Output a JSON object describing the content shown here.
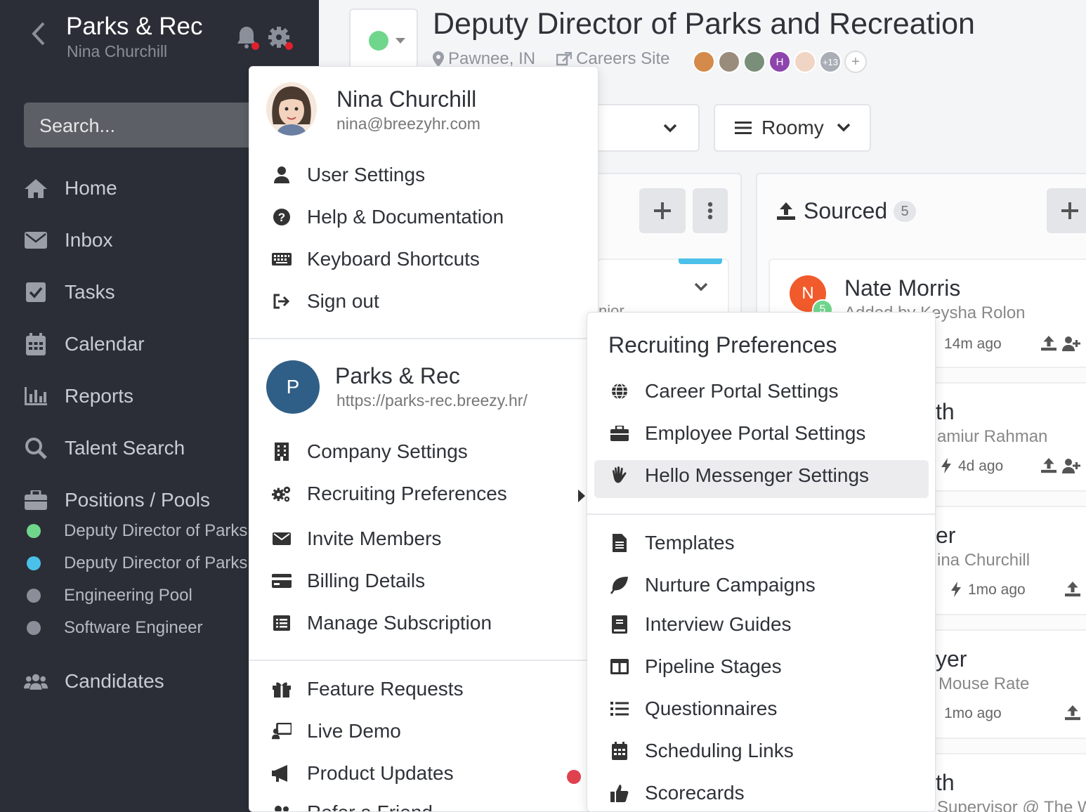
{
  "sidebar": {
    "org": "Parks & Rec",
    "user": "Nina Churchill",
    "search_placeholder": "Search...",
    "nav": [
      "Home",
      "Inbox",
      "Tasks",
      "Calendar",
      "Reports",
      "Talent Search",
      "Positions / Pools"
    ],
    "positions": [
      {
        "label": "Deputy Director of Parks and Recreation",
        "color": "#6fd68c"
      },
      {
        "label": "Deputy Director of Parks and Recreation",
        "color": "#4bc0e8"
      },
      {
        "label": "Engineering Pool",
        "color": "#8a8e98"
      },
      {
        "label": "Software Engineer",
        "color": "#8a8e98"
      }
    ],
    "candidates": "Candidates"
  },
  "header": {
    "title": "Deputy Director of Parks and Recreation",
    "location": "Pawnee, IN",
    "careers": "Careers Site",
    "extra_members": "+13",
    "add": "+",
    "member_initial": "H"
  },
  "toolbar": {
    "view": "Roomy"
  },
  "pipeline": {
    "sourced_label": "Sourced",
    "sourced_count": "5",
    "partial_text": "nior",
    "cards": [
      {
        "name": "Nate Morris",
        "initial": "N",
        "badge": "5",
        "sub": "Added by Keysha Rolon",
        "time": "14m ago"
      },
      {
        "name": "th",
        "sub": "amiur Rahman",
        "time": "4d ago"
      },
      {
        "name": "er",
        "sub": "ina Churchill",
        "time": "1mo ago"
      },
      {
        "name": "yer",
        "sub": "Mouse Rate",
        "time": "1mo ago"
      },
      {
        "name": "th",
        "sub": "Supervisor @ The W"
      }
    ]
  },
  "user_menu": {
    "name": "Nina Churchill",
    "email": "nina@breezyhr.com",
    "items": [
      "User Settings",
      "Help & Documentation",
      "Keyboard Shortcuts",
      "Sign out"
    ],
    "company_initial": "P",
    "company": "Parks & Rec",
    "company_url": "https://parks-rec.breezy.hr/",
    "company_items": [
      "Company Settings",
      "Recruiting Preferences",
      "Invite Members",
      "Billing Details",
      "Manage Subscription"
    ],
    "extra_items": [
      "Feature Requests",
      "Live Demo",
      "Product Updates",
      "Refer a Friend"
    ]
  },
  "submenu": {
    "title": "Recruiting Preferences",
    "items": [
      "Career Portal Settings",
      "Employee Portal Settings",
      "Hello Messenger Settings"
    ],
    "items2": [
      "Templates",
      "Nurture Campaigns",
      "Interview Guides",
      "Pipeline Stages",
      "Questionnaires",
      "Scheduling Links",
      "Scorecards"
    ]
  }
}
